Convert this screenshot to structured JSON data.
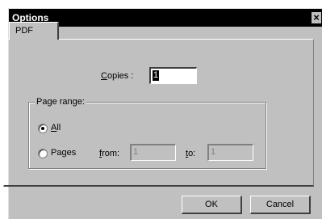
{
  "window": {
    "title": "Options",
    "close_glyph": "×"
  },
  "tabs": [
    {
      "label": "PDF"
    }
  ],
  "copies": {
    "label_prefix": "",
    "label_ul": "C",
    "label_rest": "opies :",
    "value": "1"
  },
  "page_range": {
    "group_label": "Page range:",
    "all": {
      "ul": "A",
      "rest": "ll",
      "selected": true
    },
    "pages": {
      "prefix": "Pa",
      "ul": "g",
      "rest": "es",
      "selected": false
    },
    "from": {
      "ul": "f",
      "rest": "rom:",
      "value": "1"
    },
    "to": {
      "ul": "t",
      "rest": "o:",
      "value": "1"
    }
  },
  "buttons": {
    "ok": "OK",
    "cancel": "Cancel"
  }
}
